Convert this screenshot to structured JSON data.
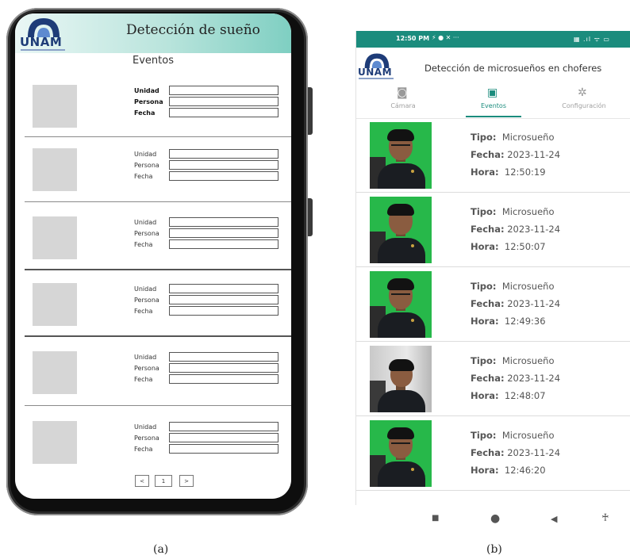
{
  "figure_a": {
    "caption": "(a)",
    "logo_text": "UNAM",
    "title": "Detección de sueño",
    "section_title": "Eventos",
    "rows": [
      {
        "labels": [
          "Unidad",
          "Persona",
          "Fecha"
        ]
      },
      {
        "labels": [
          "Unidad",
          "Persona",
          "Fecha"
        ]
      },
      {
        "labels": [
          "Unidad",
          "Persona",
          "Fecha"
        ]
      },
      {
        "labels": [
          "Unidad",
          "Persona",
          "Fecha"
        ]
      },
      {
        "labels": [
          "Unidad",
          "Persona",
          "Fecha"
        ]
      },
      {
        "labels": [
          "Unidad",
          "Persona",
          "Fecha"
        ]
      }
    ],
    "pagination": {
      "prev": "<",
      "page": "1",
      "next": ">"
    }
  },
  "figure_b": {
    "caption": "(b)",
    "status_bar": {
      "time": "12:50 PM",
      "indicators": "⚡ ● ✕ ···",
      "right": "▦ .ıl ᯤ ▭"
    },
    "logo_text": "UNAM",
    "title": "Detección de microsueños en choferes",
    "tabs": [
      {
        "label": "Cámara",
        "icon": "camera-icon",
        "glyph": "◙",
        "active": false
      },
      {
        "label": "Eventos",
        "icon": "image-icon",
        "glyph": "▣",
        "active": true
      },
      {
        "label": "Configuración",
        "icon": "gear-icon",
        "glyph": "✲",
        "active": false
      }
    ],
    "events": [
      {
        "tipo_label": "Tipo:",
        "tipo": "Microsueño",
        "fecha_label": "Fecha:",
        "fecha": "2023-11-24",
        "hora_label": "Hora:",
        "hora": "12:50:19"
      },
      {
        "tipo_label": "Tipo:",
        "tipo": "Microsueño",
        "fecha_label": "Fecha:",
        "fecha": "2023-11-24",
        "hora_label": "Hora:",
        "hora": "12:50:07"
      },
      {
        "tipo_label": "Tipo:",
        "tipo": "Microsueño",
        "fecha_label": "Fecha:",
        "fecha": "2023-11-24",
        "hora_label": "Hora:",
        "hora": "12:49:36"
      },
      {
        "tipo_label": "Tipo:",
        "tipo": "Microsueño",
        "fecha_label": "Fecha:",
        "fecha": "2023-11-24",
        "hora_label": "Hora:",
        "hora": "12:48:07"
      },
      {
        "tipo_label": "Tipo:",
        "tipo": "Microsueño",
        "fecha_label": "Fecha:",
        "fecha": "2023-11-24",
        "hora_label": "Hora:",
        "hora": "12:46:20"
      }
    ],
    "nav_bar": {
      "recents": "■",
      "home": "●",
      "back": "◀",
      "accessibility": "♰"
    }
  },
  "colors": {
    "accent": "#1b8c7d",
    "header_gradient_end": "#7fcfc2",
    "placeholder": "#d6d6d6"
  }
}
